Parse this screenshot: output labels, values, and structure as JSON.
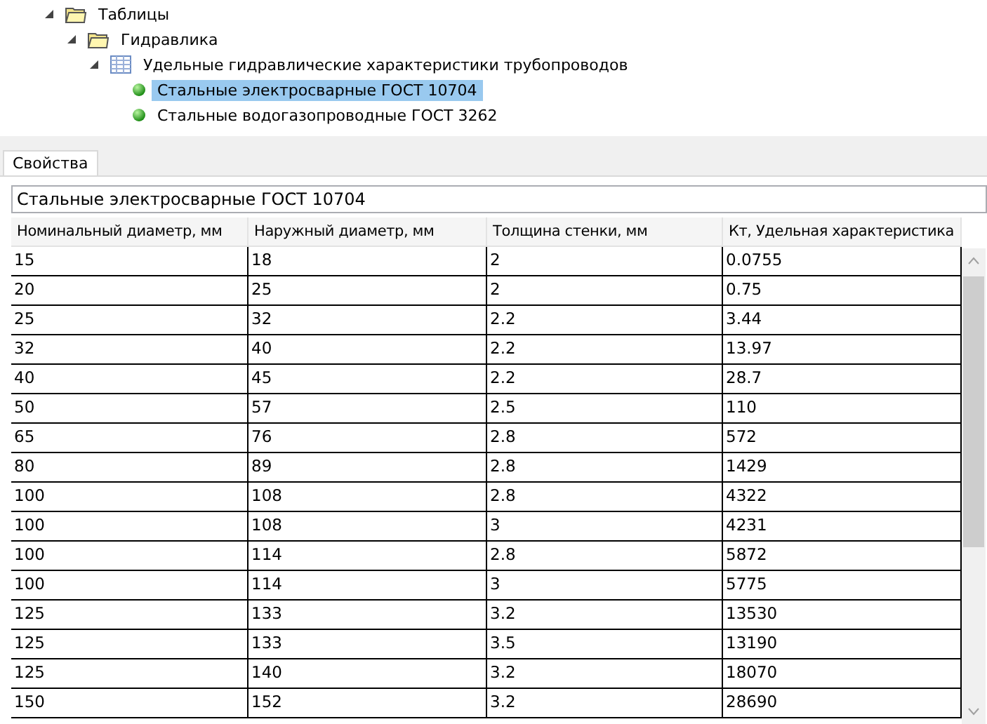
{
  "tree": [
    {
      "label": "Таблицы",
      "kind": "folder",
      "expanded": true,
      "selected": false,
      "children": [
        {
          "label": "Гидравлика",
          "kind": "folder",
          "expanded": true,
          "selected": false,
          "children": [
            {
              "label": "Удельные гидравлические характеристики трубопроводов",
              "kind": "table",
              "expanded": true,
              "selected": false,
              "children": [
                {
                  "label": "Стальные электросварные ГОСТ 10704",
                  "kind": "item",
                  "selected": true
                },
                {
                  "label": "Стальные водогазопроводные ГОСТ 3262",
                  "kind": "item",
                  "selected": false
                }
              ]
            }
          ]
        }
      ]
    }
  ],
  "tabs": [
    {
      "label": "Свойства",
      "selected": true
    }
  ],
  "name_field": {
    "value": "Стальные электросварные ГОСТ 10704"
  },
  "table": {
    "columns": [
      "Номинальный диаметр, мм",
      "Наружный диаметр, мм",
      "Толщина стенки, мм",
      "Кт, Удельная характеристика"
    ],
    "rows": [
      [
        "15",
        "18",
        "2",
        "0.0755"
      ],
      [
        "20",
        "25",
        "2",
        "0.75"
      ],
      [
        "25",
        "32",
        "2.2",
        "3.44"
      ],
      [
        "32",
        "40",
        "2.2",
        "13.97"
      ],
      [
        "40",
        "45",
        "2.2",
        "28.7"
      ],
      [
        "50",
        "57",
        "2.5",
        "110"
      ],
      [
        "65",
        "76",
        "2.8",
        "572"
      ],
      [
        "80",
        "89",
        "2.8",
        "1429"
      ],
      [
        "100",
        "108",
        "2.8",
        "4322"
      ],
      [
        "100",
        "108",
        "3",
        "4231"
      ],
      [
        "100",
        "114",
        "2.8",
        "5872"
      ],
      [
        "100",
        "114",
        "3",
        "5775"
      ],
      [
        "125",
        "133",
        "3.2",
        "13530"
      ],
      [
        "125",
        "133",
        "3.5",
        "13190"
      ],
      [
        "125",
        "140",
        "3.2",
        "18070"
      ],
      [
        "150",
        "152",
        "3.2",
        "28690"
      ]
    ]
  }
}
